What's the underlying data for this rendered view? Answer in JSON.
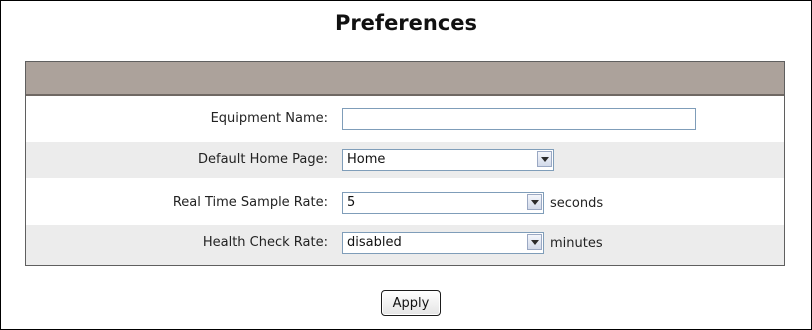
{
  "page": {
    "title": "Preferences"
  },
  "form": {
    "equipment_name": {
      "label": "Equipment Name:",
      "value": ""
    },
    "default_home_page": {
      "label": "Default Home Page:",
      "value": "Home"
    },
    "real_time_sample_rate": {
      "label": "Real Time Sample Rate:",
      "value": "5",
      "unit": "seconds"
    },
    "health_check_rate": {
      "label": "Health Check Rate:",
      "value": "disabled",
      "unit": "minutes"
    }
  },
  "actions": {
    "apply_label": "Apply"
  },
  "colors": {
    "header_bar": "#aca29b",
    "shaded_row": "#ececec",
    "input_border": "#7f9db9"
  },
  "icons": {
    "dropdown": "chevron-down-icon"
  }
}
